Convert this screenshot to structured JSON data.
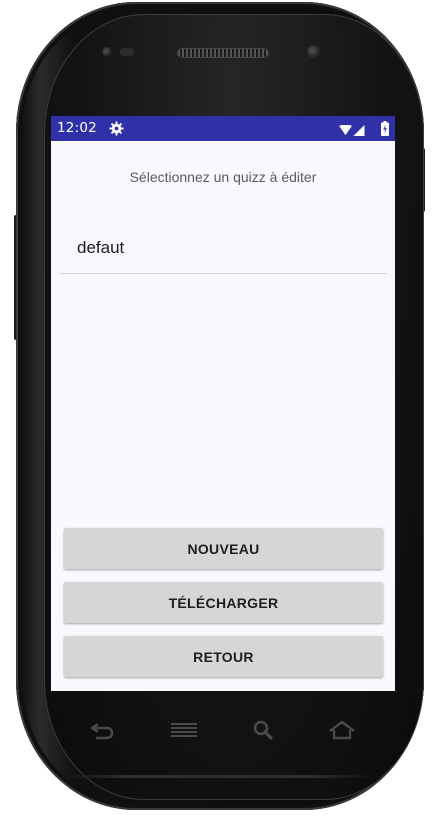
{
  "status_bar": {
    "time": "12:02",
    "background_color": "#3030a8",
    "icons": [
      "gear-icon",
      "wifi-icon",
      "signal-icon",
      "battery-icon"
    ]
  },
  "screen": {
    "heading": "Sélectionnez un quizz à éditer",
    "quiz_list": [
      {
        "label": "defaut"
      }
    ],
    "buttons": {
      "new_label": "NOUVEAU",
      "download_label": "TÉLÉCHARGER",
      "back_label": "RETOUR"
    }
  },
  "device": {
    "soft_keys": [
      "back-icon",
      "menu-icon",
      "search-icon",
      "home-icon"
    ]
  }
}
